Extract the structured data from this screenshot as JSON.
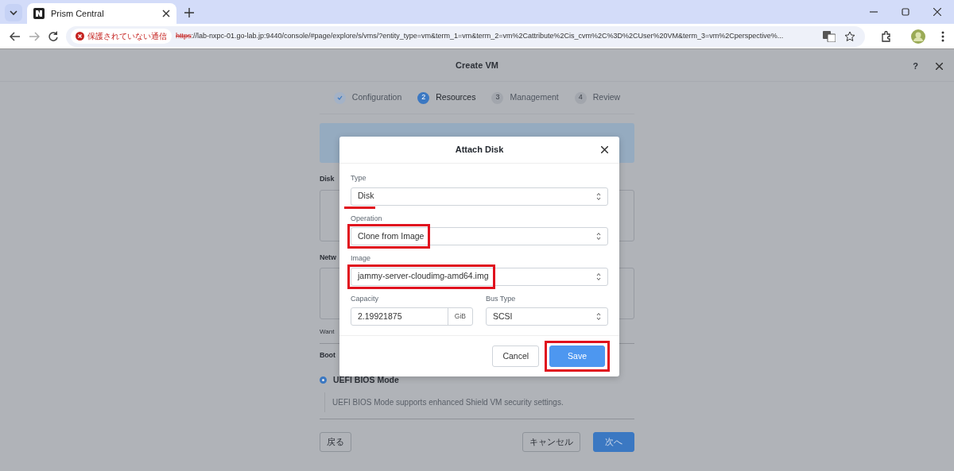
{
  "browser": {
    "tabs": [
      {
        "title": "Prism Central",
        "selected": true
      }
    ],
    "address": {
      "security_label": "保護されていない通信",
      "scheme": "https",
      "scheme_insecure": true,
      "rest": "://lab-nxpc-01.go-lab.jp:9440/console/#page/explore/s/vms/?entity_type=vm&term_1=vm&term_2=vm%2Cattribute%2Cis_cvm%2C%3D%2CUser%20VM&term_3=vm%2Cperspective%..."
    }
  },
  "page": {
    "title": "Create VM",
    "help": "?",
    "steps": [
      {
        "label": "Configuration",
        "done": true,
        "selected": false
      },
      {
        "number": "2",
        "label": "Resources",
        "done": false,
        "selected": true
      },
      {
        "number": "3",
        "label": "Management",
        "done": false,
        "selected": false
      },
      {
        "number": "4",
        "label": "Review",
        "done": false,
        "selected": false
      }
    ],
    "sections": [
      {
        "label": "Disk",
        "kind": "box"
      },
      {
        "label": "Netw",
        "kind": "box"
      },
      {
        "label": "Want",
        "kind": "note"
      }
    ],
    "boot": {
      "label": "Boot",
      "option": {
        "label": "UEFI BIOS Mode",
        "selected": true
      },
      "description": "UEFI BIOS Mode supports enhanced Shield VM security settings."
    },
    "buttons": {
      "back": "戻る",
      "cancel": "キャンセル",
      "next": "次へ"
    }
  },
  "dialog": {
    "title": "Attach Disk",
    "fields": [
      {
        "label": "Type",
        "value": "Disk",
        "underlined": true,
        "boxed": false
      },
      {
        "label": "Operation",
        "value": "Clone from Image",
        "underlined": false,
        "boxed": true
      },
      {
        "label": "Image",
        "value": "jammy-server-cloudimg-amd64.img",
        "underlined": false,
        "boxed": true
      }
    ],
    "capacity": {
      "label": "Capacity",
      "value": "2.19921875",
      "unit": "GiB"
    },
    "bus_type": {
      "label": "Bus Type",
      "value": "SCSI"
    },
    "buttons": [
      {
        "label": "Cancel",
        "kind": "secondary",
        "boxed": false
      },
      {
        "label": "Save",
        "kind": "primary",
        "boxed": true
      }
    ]
  }
}
